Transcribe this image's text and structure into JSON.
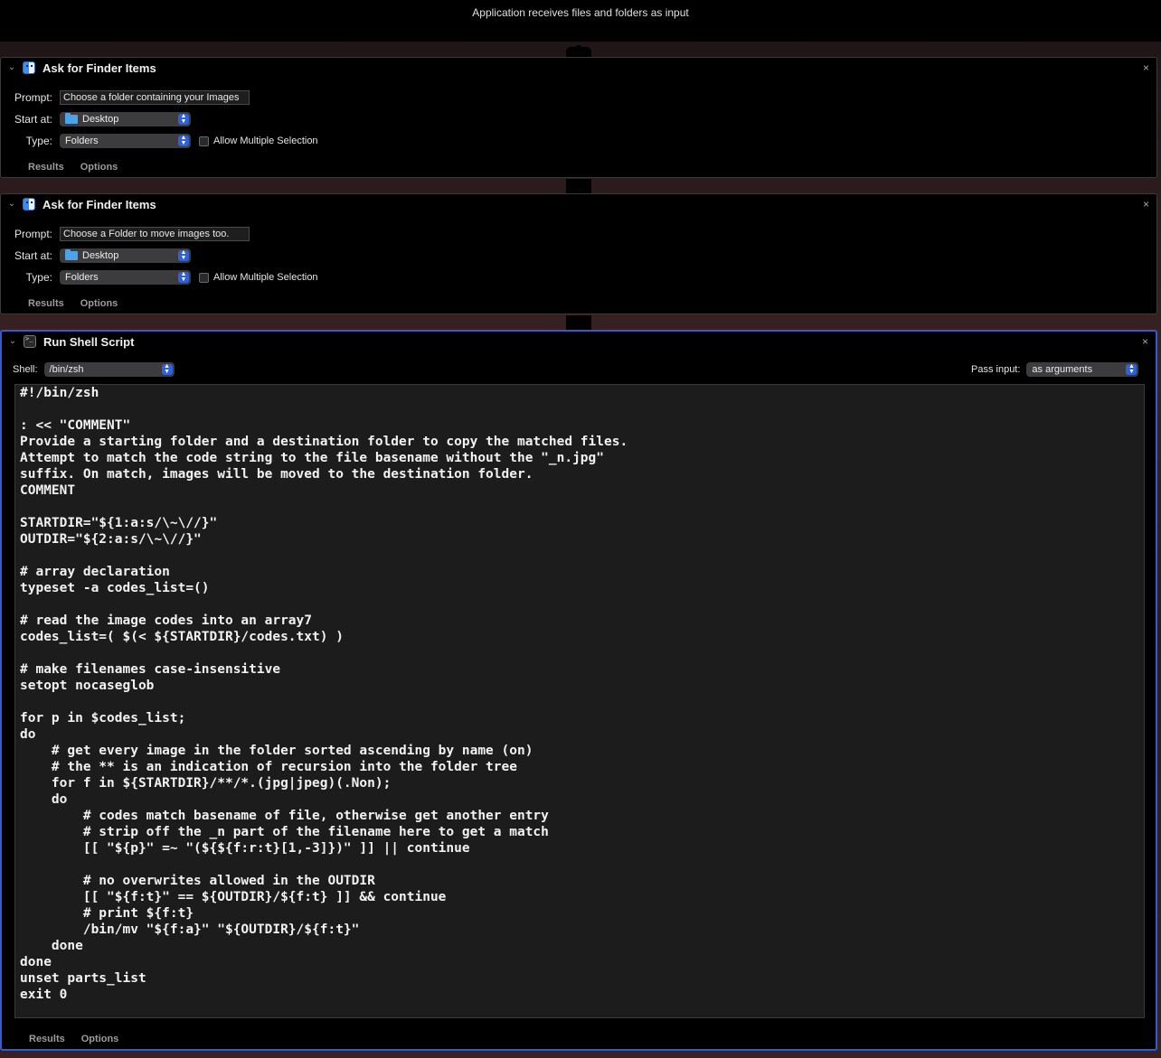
{
  "workflow": {
    "input_description": "Application receives files and folders as input"
  },
  "actions": [
    {
      "title": "Ask for Finder Items",
      "prompt_label": "Prompt:",
      "prompt_value": "Choose a folder containing your Images",
      "start_label": "Start at:",
      "start_value": "Desktop",
      "type_label": "Type:",
      "type_value": "Folders",
      "multi_label": "Allow Multiple Selection",
      "results_tab": "Results",
      "options_tab": "Options",
      "close": "×"
    },
    {
      "title": "Ask for Finder Items",
      "prompt_label": "Prompt:",
      "prompt_value": "Choose a Folder to move images too.",
      "start_label": "Start at:",
      "start_value": "Desktop",
      "type_label": "Type:",
      "type_value": "Folders",
      "multi_label": "Allow Multiple Selection",
      "results_tab": "Results",
      "options_tab": "Options",
      "close": "×"
    }
  ],
  "shell_action": {
    "title": "Run Shell Script",
    "shell_label": "Shell:",
    "shell_value": "/bin/zsh",
    "pass_input_label": "Pass input:",
    "pass_input_value": "as arguments",
    "results_tab": "Results",
    "options_tab": "Options",
    "close": "×",
    "script": "#!/bin/zsh\n\n: << \"COMMENT\"\nProvide a starting folder and a destination folder to copy the matched files.\nAttempt to match the code string to the file basename without the \"_n.jpg\"\nsuffix. On match, images will be moved to the destination folder.\nCOMMENT\n\nSTARTDIR=\"${1:a:s/\\~\\//}\"\nOUTDIR=\"${2:a:s/\\~\\//}\"\n\n# array declaration\ntypeset -a codes_list=()\n\n# read the image codes into an array7\ncodes_list=( $(< ${STARTDIR}/codes.txt) )\n\n# make filenames case-insensitive\nsetopt nocaseglob\n\nfor p in $codes_list;\ndo\n    # get every image in the folder sorted ascending by name (on)\n    # the ** is an indication of recursion into the folder tree\n    for f in ${STARTDIR}/**/*.(jpg|jpeg)(.Non);\n    do\n        # codes match basename of file, otherwise get another entry\n        # strip off the _n part of the filename here to get a match\n        [[ \"${p}\" =~ \"(${${f:r:t}[1,-3]})\" ]] || continue\n\n        # no overwrites allowed in the OUTDIR\n        [[ \"${f:t}\" == ${OUTDIR}/${f:t} ]] && continue\n        # print ${f:t}\n        /bin/mv \"${f:a}\" \"${OUTDIR}/${f:t}\"\n    done\ndone\nunset parts_list\nexit 0"
  }
}
